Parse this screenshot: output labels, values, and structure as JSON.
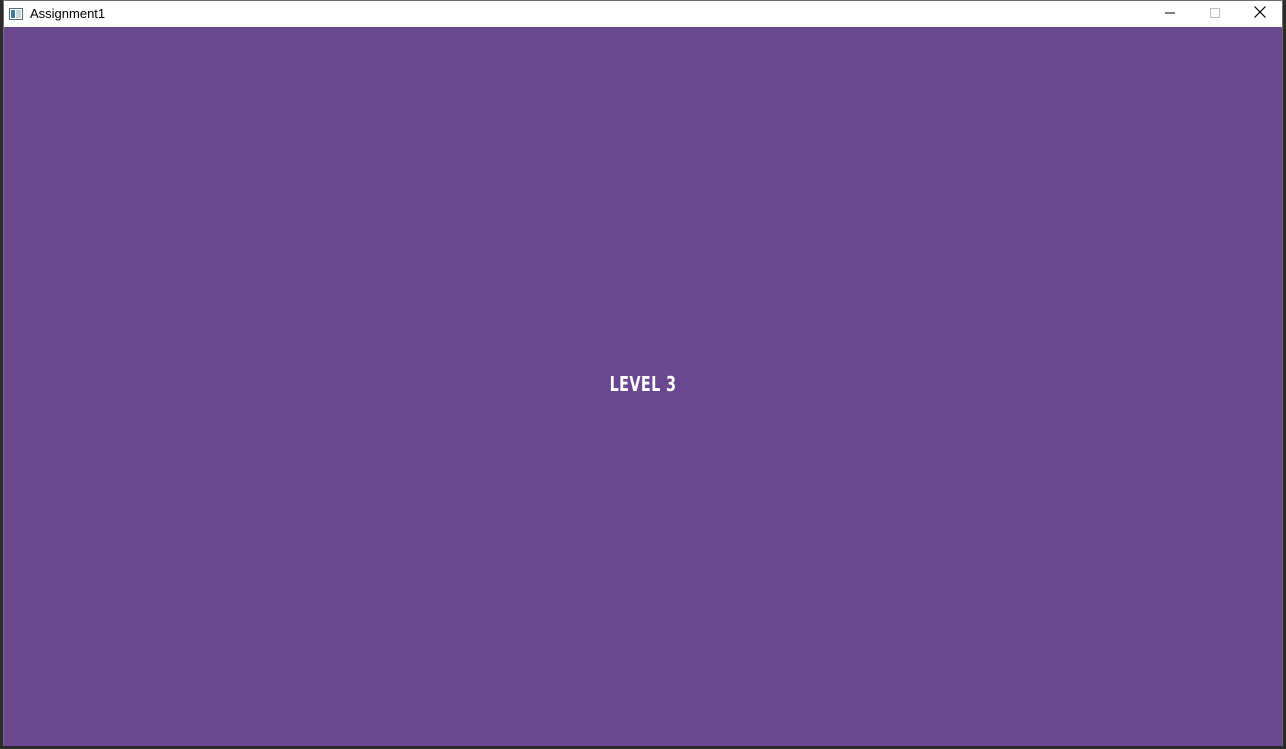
{
  "window": {
    "title": "Assignment1",
    "icon": "app-window-icon",
    "controls": {
      "minimize": "minimize-icon",
      "maximize": "maximize-icon",
      "close": "close-icon"
    }
  },
  "game": {
    "background_color": "#6a4890",
    "level_text": "LEVEL 3",
    "text_color": "#ffffff"
  }
}
